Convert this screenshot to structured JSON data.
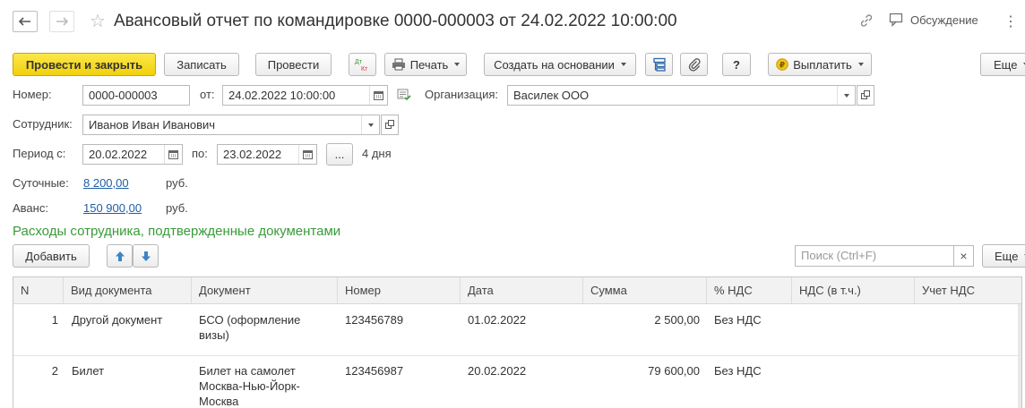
{
  "window": {
    "title": "Авансовый отчет по командировке 0000-000003 от 24.02.2022 10:00:00",
    "discussion_label": "Обсуждение"
  },
  "toolbar": {
    "post_close_label": "Провести и закрыть",
    "save_label": "Записать",
    "post_label": "Провести",
    "dtkt_label": "Дт Кт",
    "print_label": "Печать",
    "create_based_label": "Создать на основании",
    "help_label": "?",
    "pay_label": "Выплатить",
    "more_label": "Еще"
  },
  "form": {
    "number_label": "Номер:",
    "number_value": "0000-000003",
    "from_label": "от:",
    "date_value": "24.02.2022 10:00:00",
    "org_label": "Организация:",
    "org_value": "Василек ООО",
    "employee_label": "Сотрудник:",
    "employee_value": "Иванов Иван Иванович",
    "period_label": "Период с:",
    "period_from": "20.02.2022",
    "to_label": "по:",
    "period_to": "23.02.2022",
    "ellipsis_label": "...",
    "days_text": "4 дня",
    "per_diem_label": "Суточные:",
    "per_diem_value": "8 200,00",
    "per_diem_currency": "руб.",
    "advance_label": "Аванс:",
    "advance_value": "150 900,00",
    "advance_currency": "руб."
  },
  "section": {
    "title": "Расходы сотрудника, подтвержденные документами",
    "add_label": "Добавить",
    "search_placeholder": "Поиск (Ctrl+F)",
    "clear_label": "×",
    "more_label": "Еще"
  },
  "table": {
    "columns": [
      "N",
      "Вид документа",
      "Документ",
      "Номер",
      "Дата",
      "Сумма",
      "% НДС",
      "НДС (в т.ч.)",
      "Учет НДС"
    ],
    "rows": [
      {
        "n": "1",
        "doc_type": "Другой документ",
        "doc_line1": "БСО (оформление",
        "doc_line2": "визы)",
        "doc_line3": "",
        "number": "123456789",
        "date": "01.02.2022",
        "sum": "2 500,00",
        "vat_rate": "Без НДС",
        "vat": "",
        "vat_account": ""
      },
      {
        "n": "2",
        "doc_type": "Билет",
        "doc_line1": "Билет на самолет",
        "doc_line2": "Москва-Нью-Йорк-",
        "doc_line3": "Москва",
        "number": "123456987",
        "date": "20.02.2022",
        "sum": "79 600,00",
        "vat_rate": "Без НДС",
        "vat": "",
        "vat_account": ""
      }
    ]
  },
  "colors": {
    "primary_button": "#f2d00b",
    "section_title": "#3a9a39",
    "link": "#1f5ea8",
    "dtkt_red": "#d9302c",
    "dtkt_green": "#3a9a39"
  }
}
